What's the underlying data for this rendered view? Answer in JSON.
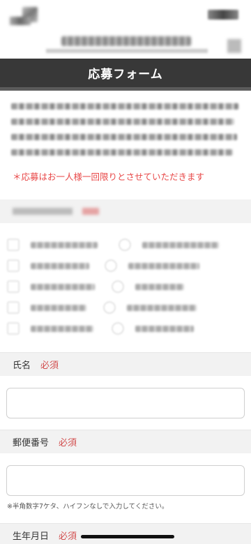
{
  "header": {
    "form_title": "応募フォーム"
  },
  "notice": "＊応募はお一人様一回限りとさせていただきます",
  "fields": {
    "name": {
      "label": "氏名",
      "required": "必須",
      "value": ""
    },
    "postal": {
      "label": "郵便番号",
      "required": "必須",
      "value": "",
      "hint": "※半角数字7ケタ、ハイフンなしで入力してください。"
    },
    "birthdate": {
      "label": "生年月日",
      "required": "必須"
    }
  },
  "colors": {
    "title_bar": "#383838",
    "notice": "#e84747",
    "required": "#d24f4f",
    "section_bg": "#f2f2f2"
  }
}
